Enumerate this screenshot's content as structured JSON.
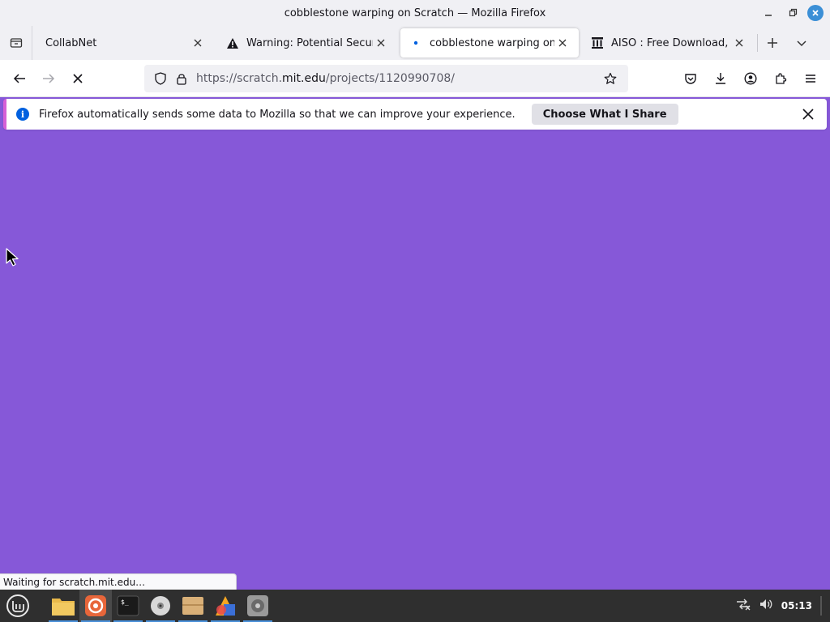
{
  "window": {
    "title": "cobblestone warping on Scratch — Mozilla Firefox"
  },
  "tabs": [
    {
      "label": "CollabNet",
      "icon": "none",
      "active": false
    },
    {
      "label": "Warning: Potential Security Risk Ahead",
      "icon": "warning-icon",
      "active": false
    },
    {
      "label": "cobblestone warping on Scratch",
      "icon": "loading-dot",
      "active": true
    },
    {
      "label": "AISO : Free Download, Borrow, and Streaming",
      "icon": "archive-icon",
      "active": false
    }
  ],
  "navbar": {
    "url_prefix": "https://scratch.",
    "url_domain": "mit.edu",
    "url_suffix": "/projects/1120990708/"
  },
  "notification": {
    "text": "Firefox automatically sends some data to Mozilla so that we can improve your experience.",
    "button_label": "Choose What I Share"
  },
  "status": {
    "text": "Waiting for scratch.mit.edu…"
  },
  "taskbar": {
    "clock": "05:13"
  },
  "colors": {
    "page_background": "#8658d8",
    "accent": "#0060df"
  }
}
